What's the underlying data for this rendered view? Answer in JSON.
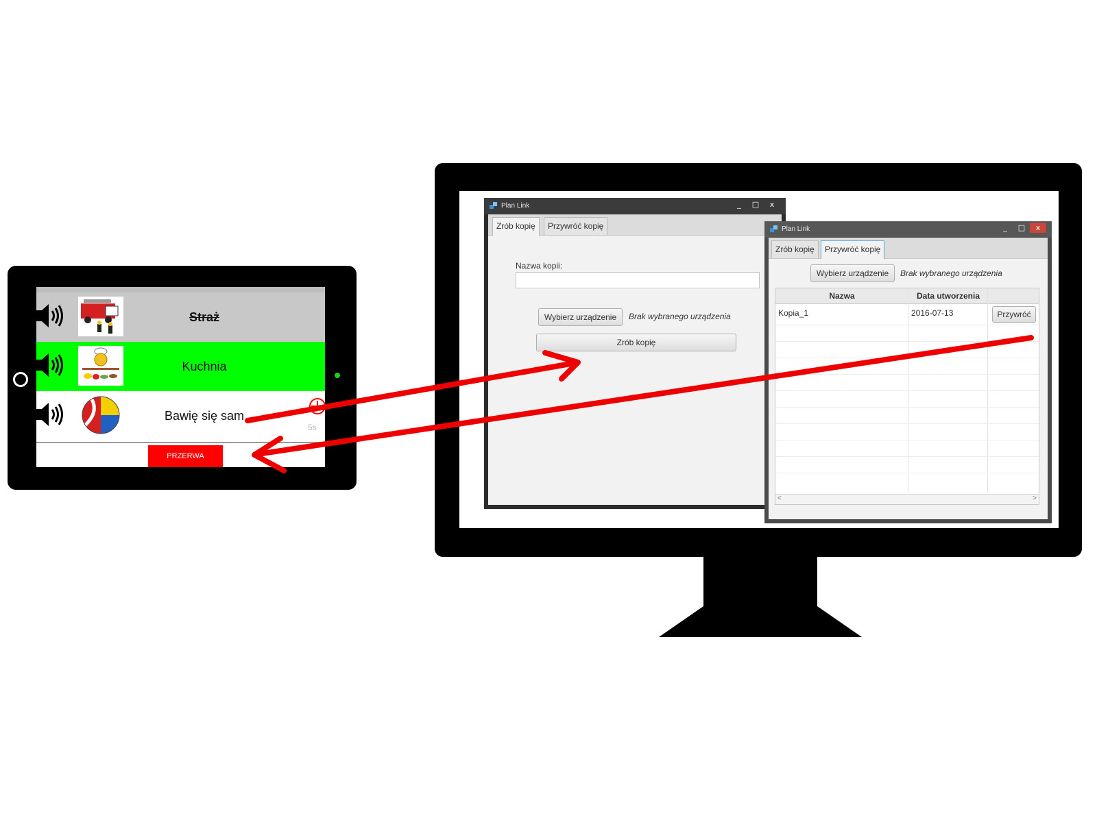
{
  "tablet": {
    "rows": [
      {
        "label": "Straż",
        "status": "done",
        "picture": "fire-truck-image"
      },
      {
        "label": "Kuchnia",
        "status": "current",
        "picture": "cooking-bear-image"
      },
      {
        "label": "Bawię się sam",
        "status": "upcoming",
        "picture": "beach-ball-image"
      }
    ],
    "timer": "5s",
    "break_button": "PRZERWA",
    "colors": {
      "done": "#c8c8c8",
      "current": "#00ff00",
      "break": "#ff0000"
    }
  },
  "window_backup": {
    "title": "Plan Link",
    "controls": [
      "_",
      "□",
      "x"
    ],
    "tabs": [
      "Zrób kopię",
      "Przywróć kopię"
    ],
    "active_tab": "Zrób kopię",
    "name_label": "Nazwa kopii:",
    "name_value": "",
    "device_button": "Wybierz urządzenie",
    "device_status": "Brak wybranego urządzenia",
    "submit_button": "Zrób kopię"
  },
  "window_restore": {
    "title": "Plan Link",
    "controls": [
      "_",
      "□",
      "x"
    ],
    "tabs": [
      "Zrób kopię",
      "Przywróć kopię"
    ],
    "active_tab": "Przywróć kopię",
    "device_button": "Wybierz urządzenie",
    "device_status": "Brak wybranego urządzenia",
    "table": {
      "columns": [
        "Nazwa",
        "Data utworzenia",
        ""
      ],
      "rows": [
        {
          "name": "Kopia_1",
          "date": "2016-07-13",
          "action": "Przywróć"
        }
      ]
    },
    "scroll_left": "<",
    "scroll_right": ">"
  },
  "arrow_color": "#ee0000"
}
